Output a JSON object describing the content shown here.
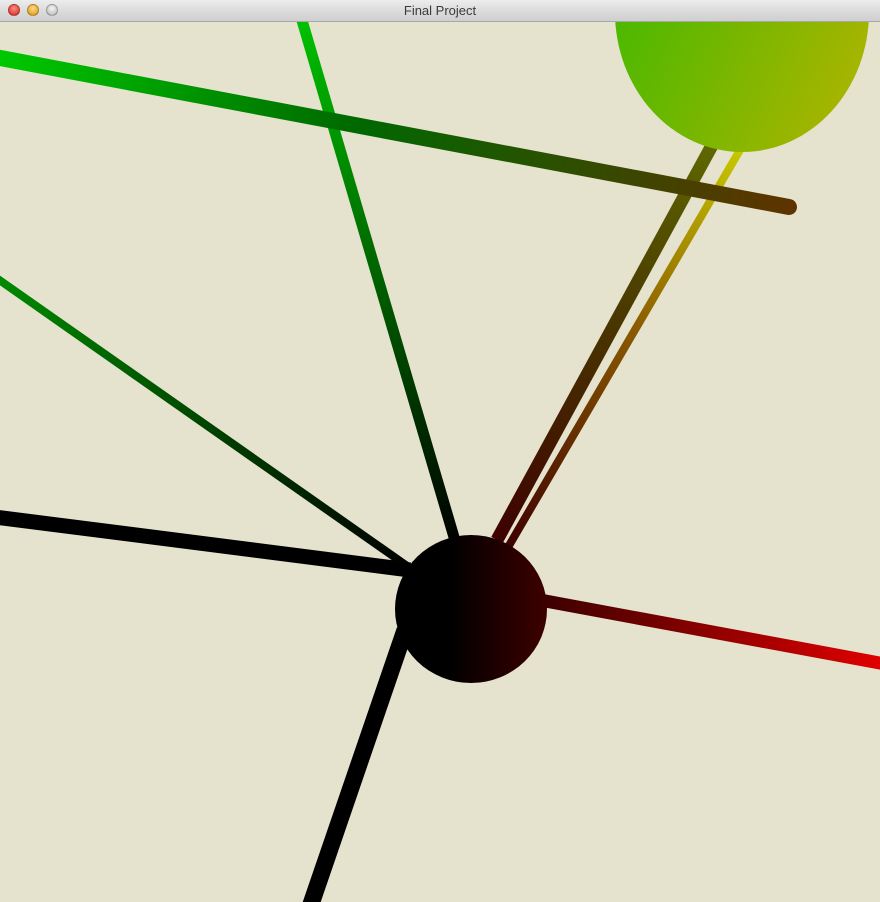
{
  "window": {
    "title": "Final Project",
    "buttons": [
      "close",
      "minimize",
      "zoom"
    ]
  },
  "scene": {
    "background_color": "#e5e3cd",
    "node_colors": {
      "center_left": "#000000",
      "center_right": "#3d0000",
      "top_right_left": "#52b800",
      "top_right_right": "#b5b300"
    },
    "edge_colors": [
      "#00c000",
      "#006a00",
      "#000000",
      "#e00000",
      "#7a8c00",
      "#c8c800",
      "#5e3300"
    ]
  }
}
